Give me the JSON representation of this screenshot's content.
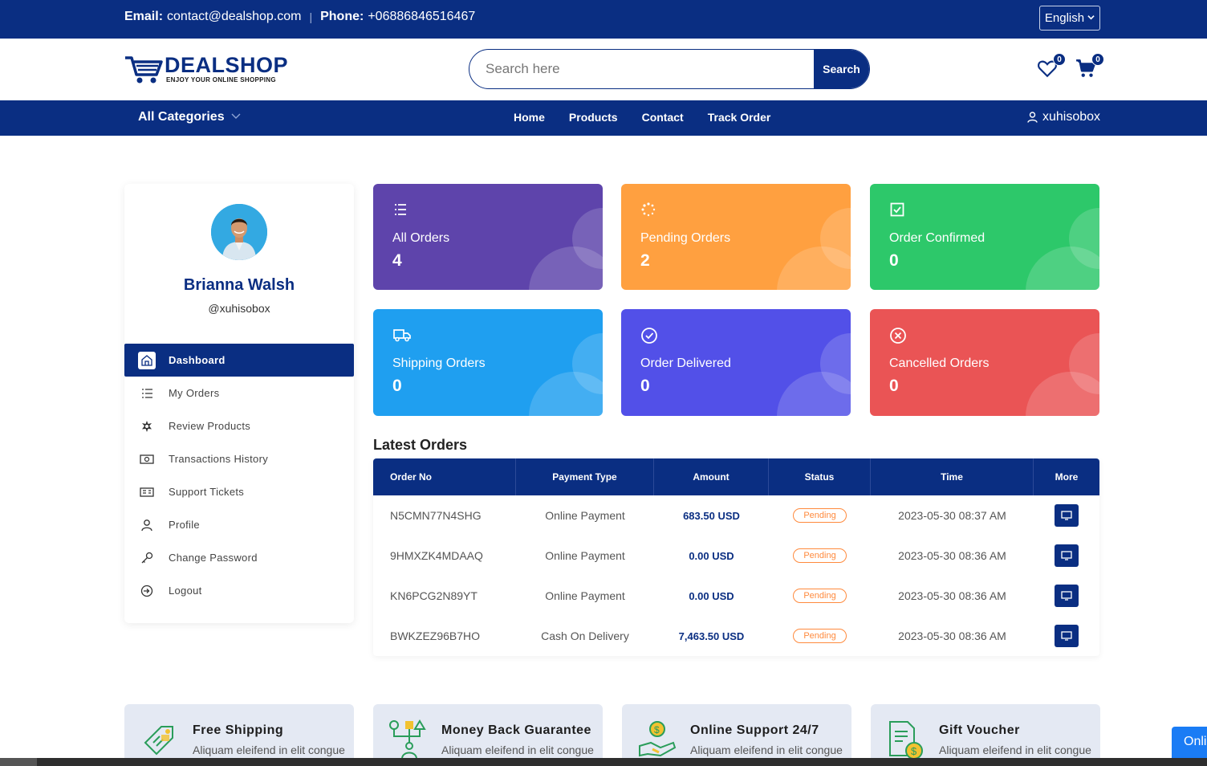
{
  "topbar": {
    "email_label": "Email:",
    "email": "contact@dealshop.com",
    "separator": "|",
    "phone_label": "Phone:",
    "phone": "+06886846516467",
    "language": "English"
  },
  "header": {
    "logo_text": "DEALSHOP",
    "logo_tagline": "ENJOY YOUR ONLINE SHOPPING",
    "search_placeholder": "Search here",
    "search_button": "Search",
    "wishlist_count": "0",
    "cart_count": "0"
  },
  "nav": {
    "categories_label": "All Categories",
    "links": [
      "Home",
      "Products",
      "Contact",
      "Track Order"
    ],
    "username": "xuhisobox"
  },
  "profile": {
    "name": "Brianna Walsh",
    "handle": "@xuhisobox"
  },
  "menu": {
    "items": [
      {
        "label": "Dashboard",
        "icon": "home-icon",
        "active": true
      },
      {
        "label": "My Orders",
        "icon": "list-icon"
      },
      {
        "label": "Review Products",
        "icon": "star-gear-icon"
      },
      {
        "label": "Transactions History",
        "icon": "money-icon"
      },
      {
        "label": "Support Tickets",
        "icon": "ticket-icon"
      },
      {
        "label": "Profile",
        "icon": "user-icon"
      },
      {
        "label": "Change Password",
        "icon": "key-icon"
      },
      {
        "label": "Logout",
        "icon": "logout-icon"
      }
    ]
  },
  "stats": [
    {
      "label": "All Orders",
      "value": "4",
      "color": "#5e44ab",
      "icon": "list-icon"
    },
    {
      "label": "Pending Orders",
      "value": "2",
      "color": "#ffa040",
      "icon": "loader-icon"
    },
    {
      "label": "Order Confirmed",
      "value": "0",
      "color": "#2dc86a",
      "icon": "check-square-icon"
    },
    {
      "label": "Shipping Orders",
      "value": "0",
      "color": "#1f9ff0",
      "icon": "truck-icon"
    },
    {
      "label": "Order Delivered",
      "value": "0",
      "color": "#5250e8",
      "icon": "check-circle-icon"
    },
    {
      "label": "Cancelled Orders",
      "value": "0",
      "color": "#ea5455",
      "icon": "x-circle-icon"
    }
  ],
  "latest_orders": {
    "title": "Latest Orders",
    "columns": [
      "Order No",
      "Payment Type",
      "Amount",
      "Status",
      "Time",
      "More"
    ],
    "rows": [
      {
        "order_no": "N5CMN77N4SHG",
        "payment": "Online Payment",
        "amount": "683.50 USD",
        "status": "Pending",
        "time": "2023-05-30 08:37 AM"
      },
      {
        "order_no": "9HMXZK4MDAAQ",
        "payment": "Online Payment",
        "amount": "0.00 USD",
        "status": "Pending",
        "time": "2023-05-30 08:36 AM"
      },
      {
        "order_no": "KN6PCG2N89YT",
        "payment": "Online Payment",
        "amount": "0.00 USD",
        "status": "Pending",
        "time": "2023-05-30 08:36 AM"
      },
      {
        "order_no": "BWKZEZ96B7HO",
        "payment": "Cash On Delivery",
        "amount": "7,463.50 USD",
        "status": "Pending",
        "time": "2023-05-30 08:36 AM"
      }
    ]
  },
  "features": [
    {
      "title": "Free Shipping",
      "desc": "Aliquam eleifend in elit congue",
      "icon": "shipping-tag-icon"
    },
    {
      "title": "Money Back Guarantee",
      "desc": "Aliquam eleifend in elit congue",
      "icon": "money-back-icon"
    },
    {
      "title": "Online Support 24/7",
      "desc": "Aliquam eleifend in elit congue",
      "icon": "support-icon"
    },
    {
      "title": "Gift Voucher",
      "desc": "Aliquam eleifend in elit congue",
      "icon": "voucher-icon"
    }
  ],
  "online_widget": "Onli",
  "colors": {
    "primary": "#0a2e82",
    "pending": "#ff8a3d",
    "feature_bg": "#e4e9f3"
  }
}
